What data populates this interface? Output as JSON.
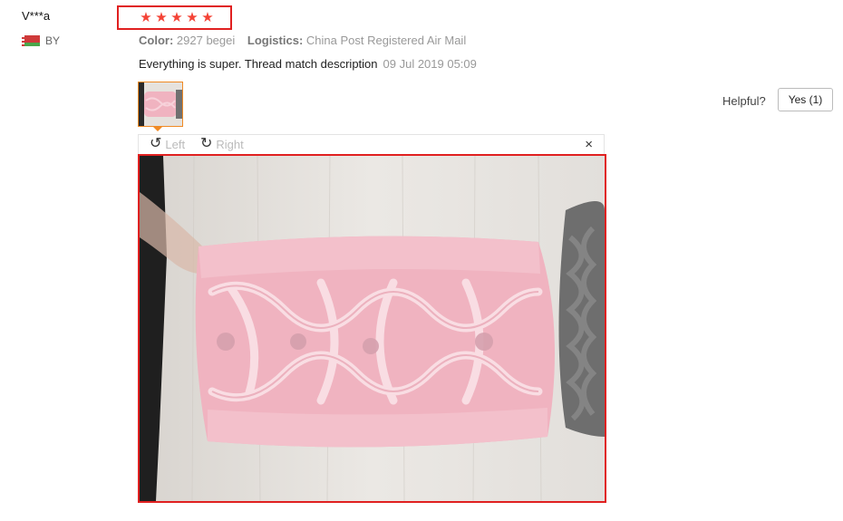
{
  "reviewer": {
    "name": "V***a",
    "country_code": "BY"
  },
  "rating": {
    "stars": 5,
    "max": 5
  },
  "review": {
    "color_label": "Color:",
    "color_value": "2927 begei",
    "logistics_label": "Logistics:",
    "logistics_value": "China Post Registered Air Mail",
    "text": "Everything is super. Thread match description",
    "date": "09 Jul 2019 05:09"
  },
  "helpful": {
    "label": "Helpful?",
    "button": "Yes (1)"
  },
  "viewer": {
    "rotate_left_label": "Left",
    "rotate_right_label": "Right",
    "close_glyph": "×"
  },
  "colors": {
    "star": "#f44336",
    "highlight_box": "#e02020",
    "thumb_border": "#f08a24",
    "knit_pink": "#f0b3c0",
    "knit_gray": "#6e6e6e"
  },
  "icons": {
    "rotate_left": "rotate-ccw-icon",
    "rotate_right": "rotate-cw-icon",
    "close": "close-icon",
    "star": "star-icon",
    "flag": "flag-icon"
  }
}
